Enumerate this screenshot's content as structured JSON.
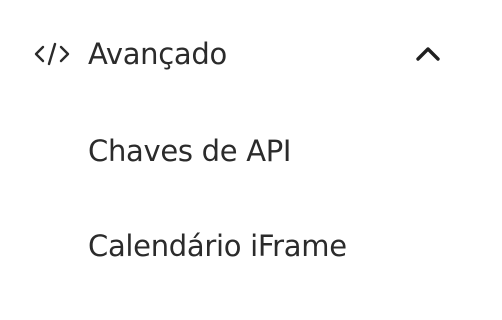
{
  "menu": {
    "section": {
      "label": "Avançado",
      "icon": "code-icon",
      "toggle_icon": "chevron-up-icon",
      "expanded": true
    },
    "items": [
      {
        "label": "Chaves de API"
      },
      {
        "label": "Calendário iFrame"
      }
    ]
  },
  "colors": {
    "text": "#2b2b2b",
    "background": "#ffffff"
  }
}
